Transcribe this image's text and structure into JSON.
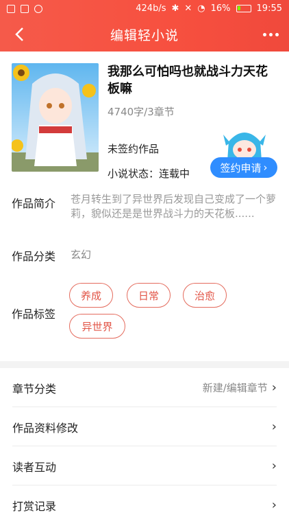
{
  "status_bar": {
    "speed": "424b/s",
    "battery": "16%",
    "time": "19:55"
  },
  "header": {
    "back_icon": "chevron-left-icon",
    "title": "编辑轻小说",
    "more_icon": "more-dots-icon"
  },
  "book": {
    "title": "我那么可怕吗也就战斗力天花板嘛",
    "meta": "4740字/3章节",
    "sign_status": "未签约作品",
    "novel_status": "小说状态：连载中",
    "sign_button": "签约申请",
    "sign_button_chevron": "›"
  },
  "details": {
    "intro_label": "作品简介",
    "intro_text": "苍月转生到了异世界后发现自己变成了一个萝莉，貌似还是是世界战斗力的天花板......",
    "category_label": "作品分类",
    "category_value": "玄幻",
    "tags_label": "作品标签",
    "tags": [
      "养成",
      "日常",
      "治愈",
      "异世界"
    ]
  },
  "menu": [
    {
      "label": "章节分类",
      "hint": "新建/编辑章节"
    },
    {
      "label": "作品资料修改",
      "hint": ""
    },
    {
      "label": "读者互动",
      "hint": ""
    },
    {
      "label": "打赏记录",
      "hint": ""
    }
  ],
  "colors": {
    "header": "#f5503f",
    "tag_border": "#e46b5d",
    "sign_button": "#2f8dff"
  }
}
